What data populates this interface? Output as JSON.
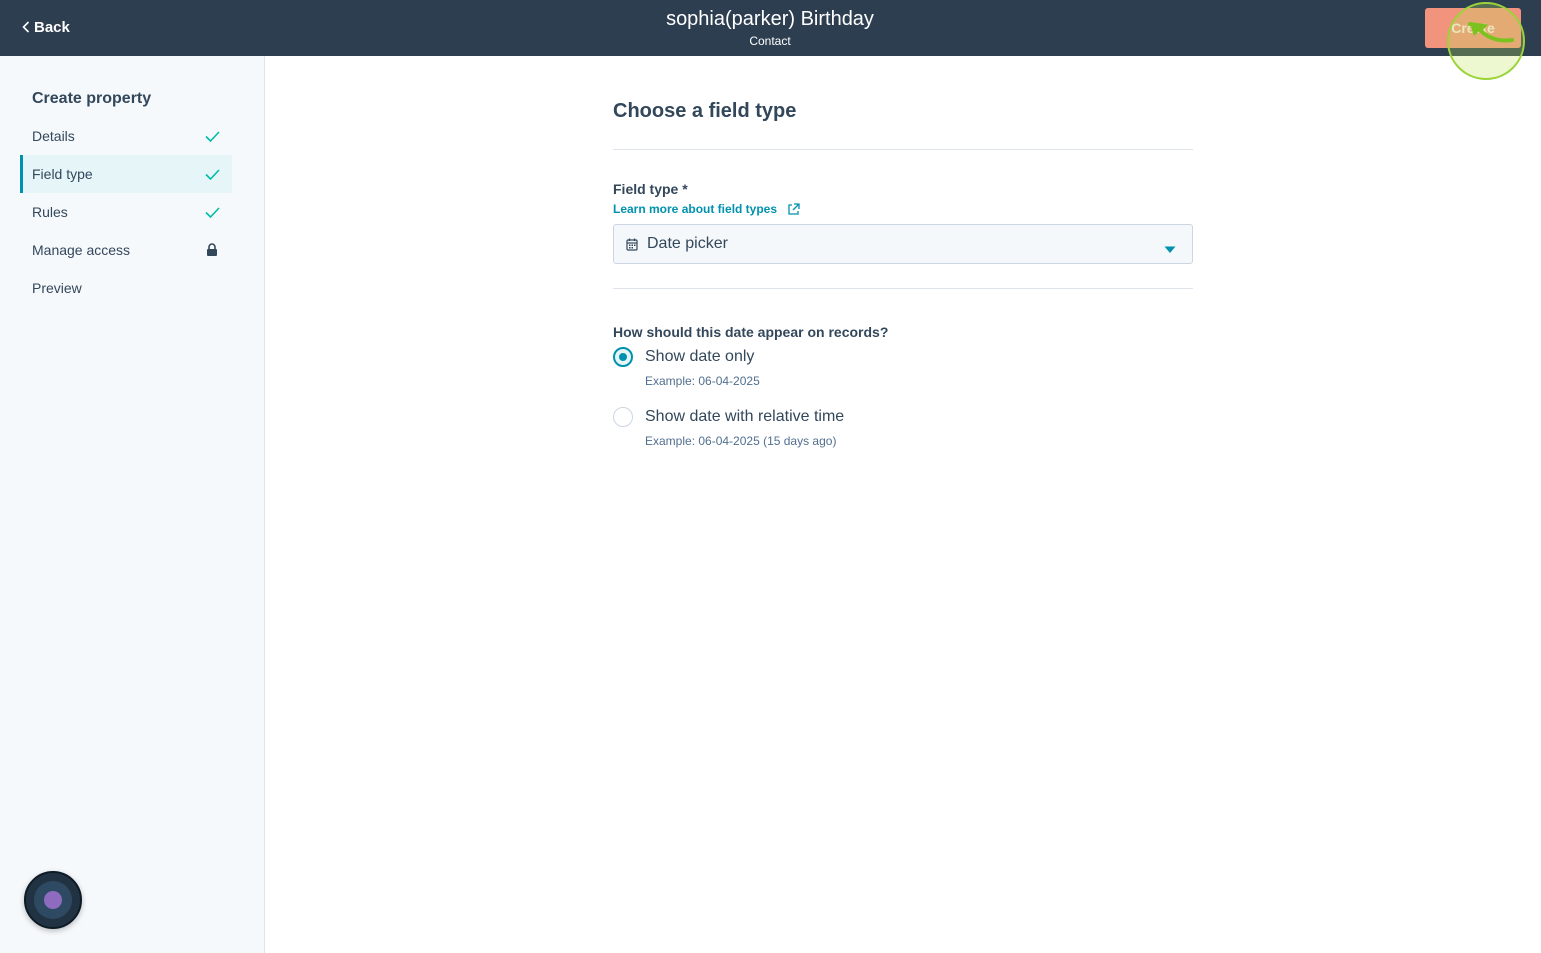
{
  "header": {
    "back_label": "Back",
    "title": "sophia(parker) Birthday",
    "subtitle": "Contact",
    "create_label": "Create"
  },
  "sidebar": {
    "heading": "Create property",
    "items": [
      {
        "label": "Details",
        "status": "check-icon",
        "active": false
      },
      {
        "label": "Field type",
        "status": "check-icon",
        "active": true
      },
      {
        "label": "Rules",
        "status": "check-icon",
        "active": false
      },
      {
        "label": "Manage access",
        "status": "lock-icon",
        "active": false
      },
      {
        "label": "Preview",
        "status": "",
        "active": false
      }
    ]
  },
  "main": {
    "title": "Choose a field type",
    "field_type": {
      "label": "Field type *",
      "learn_link": "Learn more about field types",
      "selected_value": "Date picker",
      "icon": "calendar-icon"
    },
    "date_display": {
      "question": "How should this date appear on records?",
      "options": [
        {
          "label": "Show date only",
          "example": "Example: 06-04-2025",
          "checked": true
        },
        {
          "label": "Show date with relative time",
          "example": "Example: 06-04-2025 (15 days ago)",
          "checked": false
        }
      ]
    }
  },
  "colors": {
    "header_bg": "#2d3e50",
    "accent": "#0091ae",
    "create_button": "#f2937e",
    "check": "#00bda5"
  }
}
